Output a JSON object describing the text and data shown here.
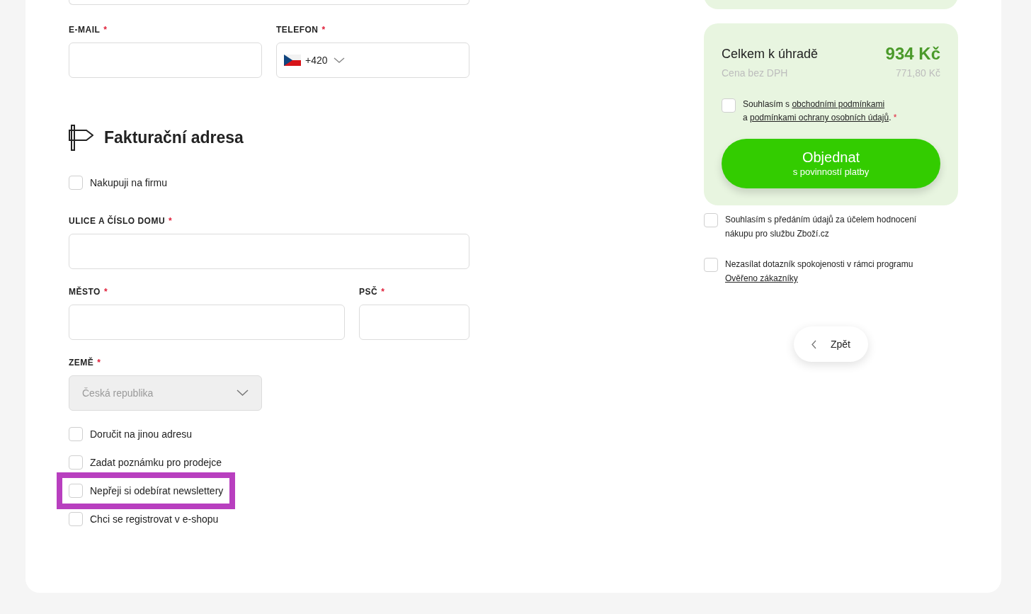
{
  "contact_fields": [
    {
      "label": "E-MAIL",
      "required_mark": "*",
      "kind": "text"
    },
    {
      "label": "TELEFON",
      "required_mark": "*",
      "kind": "phone",
      "value": "+420"
    }
  ],
  "billing": {
    "heading": "Fakturační adresa",
    "company_option": {
      "label": "Nakupuji na firmu",
      "checked": false,
      "highlighted": false
    },
    "field_rows": [
      [
        {
          "label": "ULICE A ČÍSLO DOMU",
          "required_mark": "*",
          "kind": "text"
        }
      ],
      [
        {
          "label": "MĚSTO",
          "required_mark": "*",
          "kind": "text"
        },
        {
          "label": "PSČ",
          "required_mark": "*",
          "kind": "text"
        }
      ],
      [
        {
          "label": "ZEMĚ",
          "required_mark": "*",
          "kind": "select",
          "placeholder": "Česká republika",
          "disabled": true
        }
      ]
    ],
    "options": [
      {
        "label": "Doručit na jinou adresu",
        "checked": false,
        "highlighted": false
      },
      {
        "label": "Zadat poznámku pro prodejce",
        "checked": false,
        "highlighted": false
      },
      {
        "label": "Nepřeji si odebírat newslettery",
        "checked": false,
        "highlighted": true
      },
      {
        "label": "Chci se registrovat v e-shopu",
        "checked": false,
        "highlighted": false
      }
    ]
  },
  "summary": {
    "total_label": "Celkem k úhradě",
    "total_value": "934 Kč",
    "net_label": "Cena bez DPH",
    "net_value": "771,80 Kč",
    "terms": {
      "checked": false,
      "parts": [
        {
          "kind": "text",
          "text": "Souhlasím s "
        },
        {
          "kind": "link",
          "text": "obchodními podmínkami"
        },
        {
          "kind": "break"
        },
        {
          "kind": "text",
          "text": "a "
        },
        {
          "kind": "link",
          "text": "podmínkami ochrany osobních údajů"
        },
        {
          "kind": "text",
          "text": ". "
        },
        {
          "kind": "required",
          "text": "*"
        }
      ]
    },
    "order_button": {
      "title": "Objednat",
      "subtitle": "s povinností platby"
    }
  },
  "extra_options": [
    {
      "checked": false,
      "parts": [
        {
          "kind": "text",
          "text": "Souhlasím s předáním údajů za účelem hodnocení nákupu pro službu Zboží.cz"
        }
      ]
    },
    {
      "checked": false,
      "parts": [
        {
          "kind": "text",
          "text": "Nezasílat dotazník spokojenosti v rámci programu "
        },
        {
          "kind": "break"
        },
        {
          "kind": "link",
          "text": "Ověřeno zákazníky"
        }
      ]
    }
  ],
  "back_button": {
    "label": "Zpět"
  }
}
